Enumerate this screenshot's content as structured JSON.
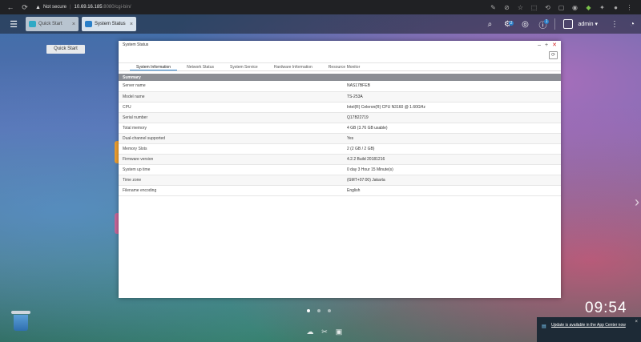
{
  "browser": {
    "security_label": "Not secure",
    "url_host": "10.69.16.185",
    "url_rest": ":8080/cgi-bin/"
  },
  "taskbar": {
    "tabs": [
      {
        "label": "Quick Start",
        "close": "×"
      },
      {
        "label": "System Status",
        "close": "×"
      }
    ],
    "notification_badge": "2",
    "info_badge": "1",
    "user_label": "admin ▾"
  },
  "quick_start_button": "Quick Start",
  "window": {
    "title": "System Status",
    "subtabs": [
      "System Information",
      "Network Status",
      "System Service",
      "Hardware Information",
      "Resource Monitor"
    ],
    "section_title": "Summary",
    "rows": [
      {
        "label": "Server name",
        "value": "NAS17BFEB"
      },
      {
        "label": "Model name",
        "value": "TS-253A"
      },
      {
        "label": "CPU",
        "value": "Intel(R) Celeron(R) CPU N3160 @ 1.60GHz"
      },
      {
        "label": "Serial number",
        "value": "Q17B22719"
      },
      {
        "label": "Total memory",
        "value": "4 GB (3.76 GB usable)"
      },
      {
        "label": "Dual-channel supported",
        "value": "Yes"
      },
      {
        "label": "Memory Slots",
        "value": "2 (2 GB / 2 GB)"
      },
      {
        "label": "Firmware version",
        "value": "4.2.2 Build 20181216"
      },
      {
        "label": "System up time",
        "value": "0 day 3 Hour 15 Minute(s)"
      },
      {
        "label": "Time zone",
        "value": "(GMT+07:00) Jakarta"
      },
      {
        "label": "Filename encoding",
        "value": "English"
      }
    ]
  },
  "clock": "09:54",
  "notification": {
    "text": "Update is available in the App Center now",
    "close": "×"
  }
}
